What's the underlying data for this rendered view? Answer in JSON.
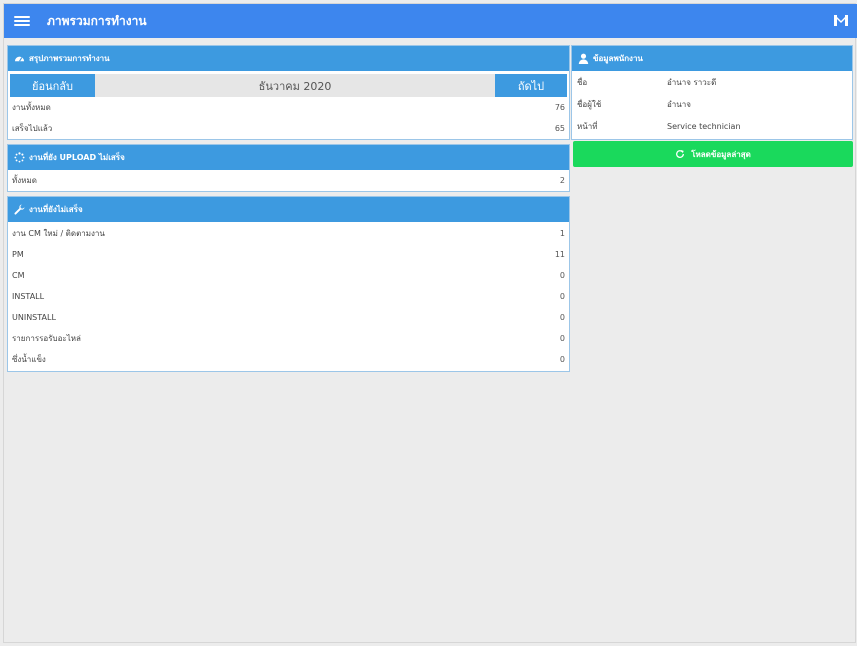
{
  "header": {
    "title": "ภาพรวมการทำงาน",
    "menu_icon": "hamburger-icon",
    "right_icon": "logo-icon"
  },
  "summary": {
    "title": "สรุปภาพรวมการทำงาน",
    "prev_label": "ย้อนกลับ",
    "month": "ธันวาคม 2020",
    "next_label": "ถัดไป",
    "rows": [
      {
        "label": "งานทั้งหมด",
        "value": "76"
      },
      {
        "label": "เสร็จไปแล้ว",
        "value": "65"
      }
    ]
  },
  "upload": {
    "title": "งานที่ยัง UPLOAD ไม่เสร็จ",
    "rows": [
      {
        "label": "ทั้งหมด",
        "value": "2"
      }
    ]
  },
  "pending": {
    "title": "งานที่ยังไม่เสร็จ",
    "rows": [
      {
        "label": "งาน CM ใหม่ / ติดตามงาน",
        "value": "1"
      },
      {
        "label": "PM",
        "value": "11"
      },
      {
        "label": "CM",
        "value": "0"
      },
      {
        "label": "INSTALL",
        "value": "0"
      },
      {
        "label": "UNINSTALL",
        "value": "0"
      },
      {
        "label": "รายการรอรับอะไหล่",
        "value": "0"
      },
      {
        "label": "ซึ่งน้ำแข็ง",
        "value": "0"
      }
    ]
  },
  "employee": {
    "title": "ข้อมูลพนักงาน",
    "rows": [
      {
        "label": "ชื่อ",
        "value": "อำนาจ ราวะดี"
      },
      {
        "label": "ชื่อผู้ใช้",
        "value": "อำนาจ"
      },
      {
        "label": "หน้าที่",
        "value": "Service technician"
      }
    ]
  },
  "reload_label": "โหลดข้อมูลล่าสุด"
}
